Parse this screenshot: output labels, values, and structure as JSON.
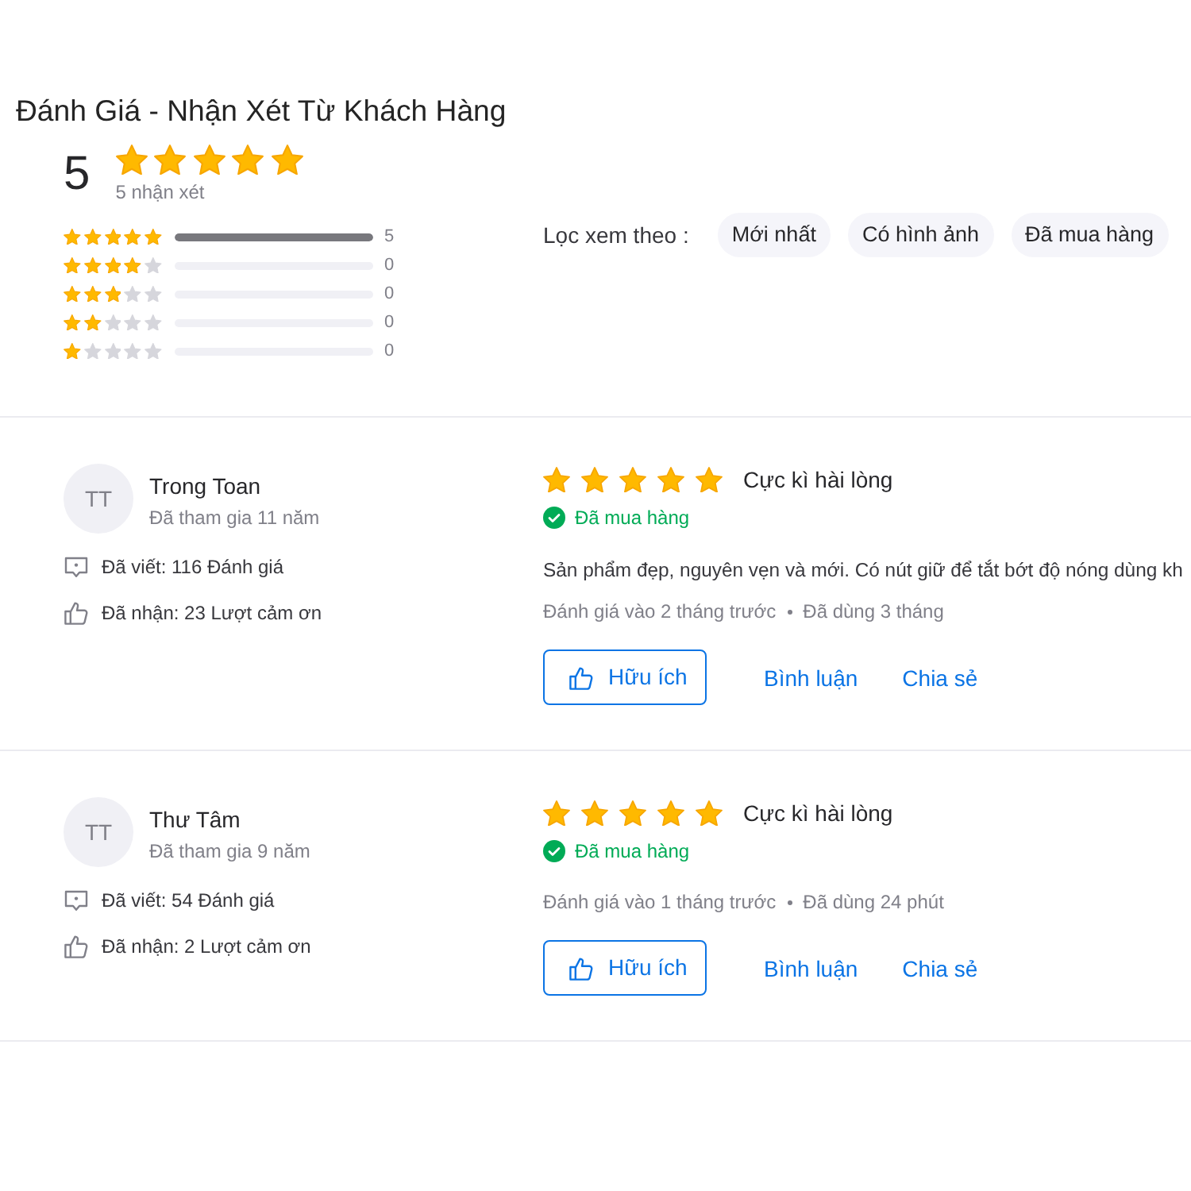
{
  "title": "Đánh Giá - Nhận Xét Từ Khách Hàng",
  "summary": {
    "score": "5",
    "stars": 5,
    "count": "5 nhận xét"
  },
  "distribution": [
    {
      "stars": 5,
      "level": 1,
      "count": "5"
    },
    {
      "stars": 4,
      "level": 0,
      "count": "0"
    },
    {
      "stars": 3,
      "level": 0,
      "count": "0"
    },
    {
      "stars": 2,
      "level": 0,
      "count": "0"
    },
    {
      "stars": 1,
      "level": 0,
      "count": "0"
    }
  ],
  "filter": {
    "label": "Lọc xem theo :",
    "options": [
      {
        "label": "Mới nhất",
        "selected": false
      },
      {
        "label": "Có hình ảnh",
        "selected": false
      },
      {
        "label": "Đã mua hàng",
        "selected": false
      }
    ]
  },
  "reviews": [
    {
      "reviewer": {
        "initials": "TT",
        "name": "Trong Toan",
        "joined": "Đã tham gia 11 năm",
        "stats": [
          {
            "kind": "reviews",
            "text": "Đã viết: 116 Đánh giá"
          },
          {
            "kind": "thanks",
            "text": "Đã nhận: 23 Lượt cảm ơn"
          }
        ]
      },
      "stars": 5,
      "headline": "Cực kì hài lòng",
      "purchase_badge": "Đã mua hàng",
      "body": "Sản phẩm đẹp, nguyên vẹn và mới. Có nút giữ để tắt bớt độ nóng dùng kh",
      "date": "Đánh giá vào 2 tháng trước",
      "usage": "Đã dùng 3 tháng",
      "actions": [
        {
          "kind": "outline",
          "label": "Hữu ích"
        },
        {
          "kind": "link",
          "label": "Bình luận"
        },
        {
          "kind": "link",
          "label": "Chia sẻ"
        }
      ]
    },
    {
      "reviewer": {
        "initials": "TT",
        "name": "Thư Tâm",
        "joined": "Đã tham gia 9 năm",
        "stats": [
          {
            "kind": "reviews",
            "text": "Đã viết: 54 Đánh giá"
          },
          {
            "kind": "thanks",
            "text": "Đã nhận: 2 Lượt cảm ơn"
          }
        ]
      },
      "stars": 5,
      "headline": "Cực kì hài lòng",
      "purchase_badge": "Đã mua hàng",
      "date": "Đánh giá vào 1 tháng trước",
      "usage": "Đã dùng 24 phút",
      "actions": [
        {
          "kind": "outline",
          "label": "Hữu ích"
        },
        {
          "kind": "link",
          "label": "Bình luận"
        },
        {
          "kind": "link",
          "label": "Chia sẻ"
        }
      ]
    }
  ]
}
